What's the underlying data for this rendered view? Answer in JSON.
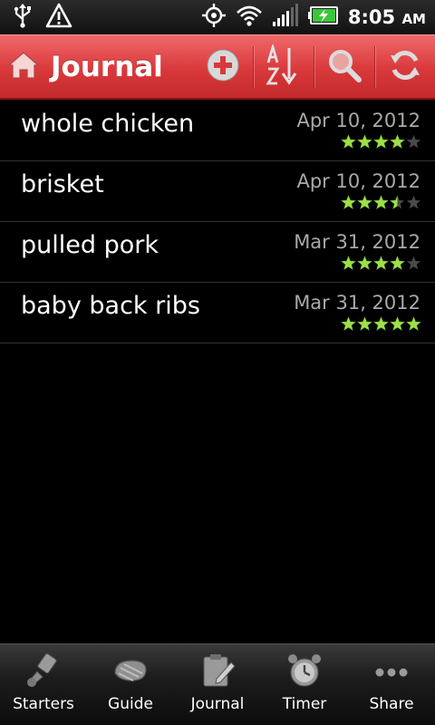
{
  "status_bar": {
    "time": "8:05",
    "ampm": "AM",
    "icons": [
      "usb-icon",
      "warning-icon",
      "gps-icon",
      "wifi-icon",
      "signal-icon",
      "battery-charging-icon"
    ]
  },
  "action_bar": {
    "title": "Journal",
    "icons": [
      "home-icon",
      "add-icon",
      "sort-az-icon",
      "search-icon",
      "refresh-icon"
    ]
  },
  "entries": [
    {
      "name": "whole chicken",
      "date": "Apr 10, 2012",
      "rating": 4
    },
    {
      "name": "brisket",
      "date": "Apr 10, 2012",
      "rating": 3.5
    },
    {
      "name": "pulled pork",
      "date": "Mar 31, 2012",
      "rating": 4
    },
    {
      "name": "baby back ribs",
      "date": "Mar 31, 2012",
      "rating": 5
    }
  ],
  "tabs": [
    {
      "label": "Starters",
      "icon": "chimney-starter-icon"
    },
    {
      "label": "Guide",
      "icon": "steak-icon"
    },
    {
      "label": "Journal",
      "icon": "notepad-pencil-icon"
    },
    {
      "label": "Timer",
      "icon": "alarm-clock-icon"
    },
    {
      "label": "Share",
      "icon": "more-dots-icon"
    }
  ],
  "colors": {
    "action_bar": "#d9393b",
    "star_filled": "#9ee04a",
    "star_empty": "#4a4a4a",
    "date_text": "#a9a9a9"
  }
}
